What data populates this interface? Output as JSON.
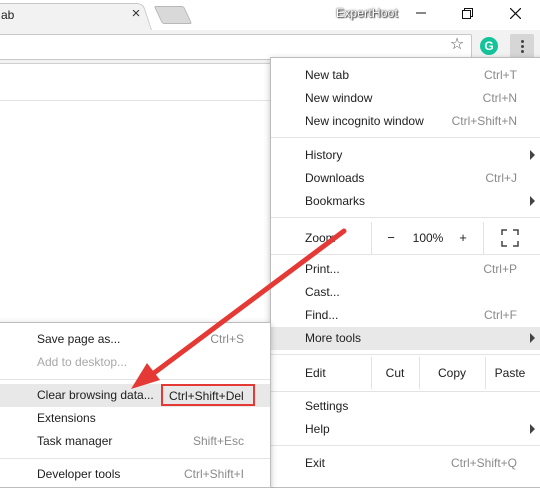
{
  "window": {
    "tab_title": "ab",
    "tab_close": "×",
    "profile_name": "ExpertHoot"
  },
  "toolbar": {
    "star_icon": "☆",
    "extension_letter": "G"
  },
  "main_menu": {
    "new_tab": {
      "label": "New tab",
      "shortcut": "Ctrl+T"
    },
    "new_window": {
      "label": "New window",
      "shortcut": "Ctrl+N"
    },
    "new_incognito": {
      "label": "New incognito window",
      "shortcut": "Ctrl+Shift+N"
    },
    "history": {
      "label": "History"
    },
    "downloads": {
      "label": "Downloads",
      "shortcut": "Ctrl+J"
    },
    "bookmarks": {
      "label": "Bookmarks"
    },
    "zoom": {
      "label": "Zoom",
      "minus": "−",
      "value": "100%",
      "plus": "+"
    },
    "print": {
      "label": "Print...",
      "shortcut": "Ctrl+P"
    },
    "cast": {
      "label": "Cast..."
    },
    "find": {
      "label": "Find...",
      "shortcut": "Ctrl+F"
    },
    "more_tools": {
      "label": "More tools"
    },
    "edit": {
      "label": "Edit",
      "cut": "Cut",
      "copy": "Copy",
      "paste": "Paste"
    },
    "settings": {
      "label": "Settings"
    },
    "help": {
      "label": "Help"
    },
    "exit": {
      "label": "Exit",
      "shortcut": "Ctrl+Shift+Q"
    }
  },
  "sub_menu": {
    "save_page": {
      "label": "Save page as...",
      "shortcut": "Ctrl+S"
    },
    "add_to_desktop": {
      "label": "Add to desktop..."
    },
    "clear_browsing": {
      "label": "Clear browsing data...",
      "shortcut": "Ctrl+Shift+Del"
    },
    "extensions": {
      "label": "Extensions"
    },
    "task_manager": {
      "label": "Task manager",
      "shortcut": "Shift+Esc"
    },
    "developer_tools": {
      "label": "Developer tools",
      "shortcut": "Ctrl+Shift+I"
    }
  },
  "colors": {
    "annotation_red": "#e53935",
    "hover_gray": "#e8e8e8",
    "shortcut_gray": "#8a8a8a"
  }
}
